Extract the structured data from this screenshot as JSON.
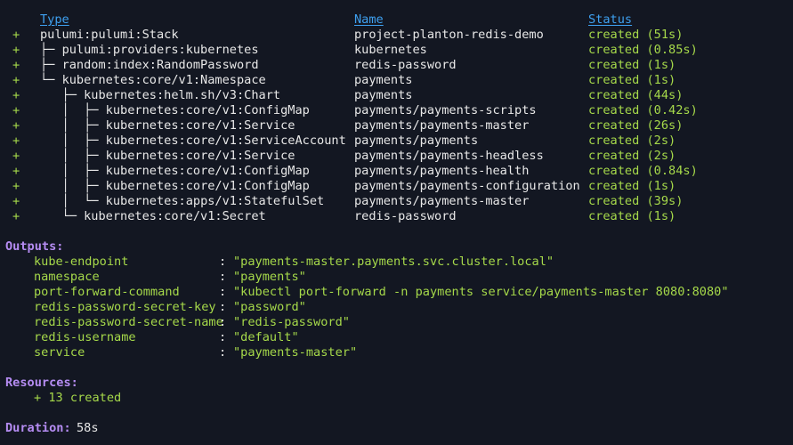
{
  "headers": {
    "type": "Type",
    "name": "Name",
    "status": "Status"
  },
  "resources": [
    {
      "op": "+",
      "prefix": "",
      "type": "pulumi:pulumi:Stack",
      "name": "project-planton-redis-demo",
      "status": "created (51s)"
    },
    {
      "op": "+",
      "prefix": "├─ ",
      "type": "pulumi:providers:kubernetes",
      "name": "kubernetes",
      "status": "created (0.85s)"
    },
    {
      "op": "+",
      "prefix": "├─ ",
      "type": "random:index:RandomPassword",
      "name": "redis-password",
      "status": "created (1s)"
    },
    {
      "op": "+",
      "prefix": "└─ ",
      "type": "kubernetes:core/v1:Namespace",
      "name": "payments",
      "status": "created (1s)"
    },
    {
      "op": "+",
      "prefix": "   ├─ ",
      "type": "kubernetes:helm.sh/v3:Chart",
      "name": "payments",
      "status": "created (44s)"
    },
    {
      "op": "+",
      "prefix": "   │  ├─ ",
      "type": "kubernetes:core/v1:ConfigMap",
      "name": "payments/payments-scripts",
      "status": "created (0.42s)"
    },
    {
      "op": "+",
      "prefix": "   │  ├─ ",
      "type": "kubernetes:core/v1:Service",
      "name": "payments/payments-master",
      "status": "created (26s)"
    },
    {
      "op": "+",
      "prefix": "   │  ├─ ",
      "type": "kubernetes:core/v1:ServiceAccount",
      "name": "payments/payments",
      "status": "created (2s)"
    },
    {
      "op": "+",
      "prefix": "   │  ├─ ",
      "type": "kubernetes:core/v1:Service",
      "name": "payments/payments-headless",
      "status": "created (2s)"
    },
    {
      "op": "+",
      "prefix": "   │  ├─ ",
      "type": "kubernetes:core/v1:ConfigMap",
      "name": "payments/payments-health",
      "status": "created (0.84s)"
    },
    {
      "op": "+",
      "prefix": "   │  ├─ ",
      "type": "kubernetes:core/v1:ConfigMap",
      "name": "payments/payments-configuration",
      "status": "created (1s)"
    },
    {
      "op": "+",
      "prefix": "   │  └─ ",
      "type": "kubernetes:apps/v1:StatefulSet",
      "name": "payments/payments-master",
      "status": "created (39s)"
    },
    {
      "op": "+",
      "prefix": "   └─ ",
      "type": "kubernetes:core/v1:Secret",
      "name": "redis-password",
      "status": "created (1s)"
    }
  ],
  "outputs": {
    "heading": "Outputs:",
    "items": [
      {
        "key": "kube-endpoint",
        "value": "\"payments-master.payments.svc.cluster.local\""
      },
      {
        "key": "namespace",
        "value": "\"payments\""
      },
      {
        "key": "port-forward-command",
        "value": "\"kubectl port-forward -n payments service/payments-master 8080:8080\""
      },
      {
        "key": "redis-password-secret-key",
        "value": "\"password\""
      },
      {
        "key": "redis-password-secret-name",
        "value": "\"redis-password\""
      },
      {
        "key": "redis-username",
        "value": "\"default\""
      },
      {
        "key": "service",
        "value": "\"payments-master\""
      }
    ]
  },
  "summary": {
    "resources_heading": "Resources:",
    "resources_line": "+ 13 created",
    "duration_label": "Duration:",
    "duration_value": "58s"
  },
  "colors": {
    "background": "#131722",
    "created": "#a6d94a",
    "header": "#3ea0f0",
    "section": "#b58cf2"
  }
}
